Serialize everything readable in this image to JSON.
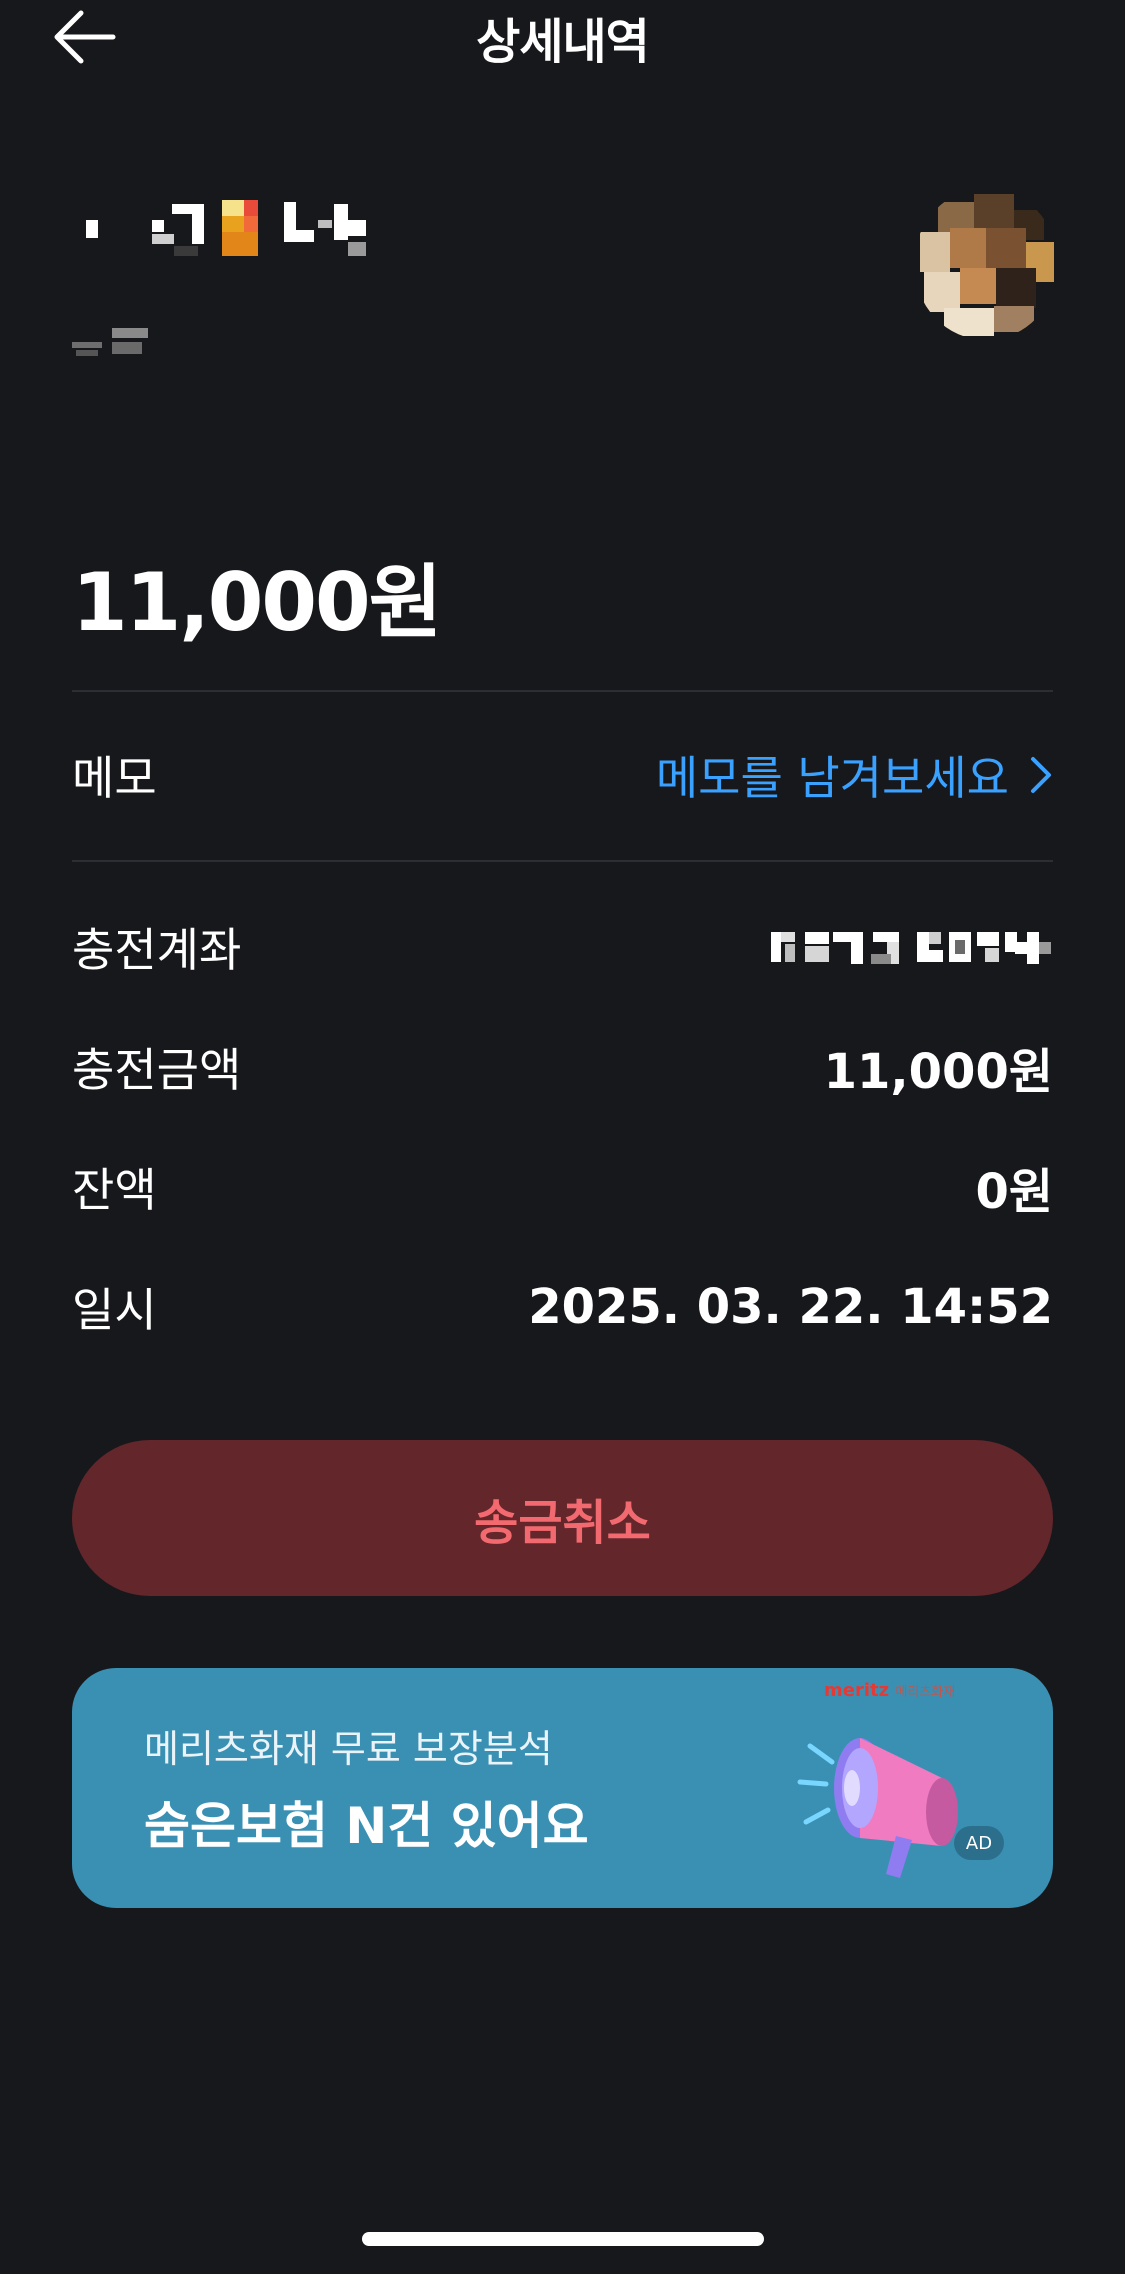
{
  "header": {
    "title": "상세내역",
    "back_icon": "arrow-left-icon"
  },
  "recipient": {
    "name_masked": true,
    "sub_masked": true,
    "avatar": "avatar-image"
  },
  "amount": "11,000원",
  "memo": {
    "label": "메모",
    "placeholder_link": "메모를 남겨보세요",
    "chevron_icon": "chevron-right-icon"
  },
  "details": [
    {
      "label": "충전계좌",
      "value": ""
    },
    {
      "label": "충전금액",
      "value": "11,000원"
    },
    {
      "label": "잔액",
      "value": "0원"
    },
    {
      "label": "일시",
      "value": "2025. 03. 22. 14:52"
    }
  ],
  "cancel_button": "송금취소",
  "ad": {
    "subtitle": "메리츠화재 무료 보장분석",
    "title": "숨은보험 N건 있어요",
    "brand": "meritz",
    "brand_sub": "메리츠화재",
    "badge": "AD",
    "icon": "megaphone-icon"
  },
  "colors": {
    "background": "#17181c",
    "link": "#3aa1ff",
    "cancel_bg": "#62262b",
    "cancel_text": "#f26a6f",
    "ad_bg": "#3a90b3"
  }
}
